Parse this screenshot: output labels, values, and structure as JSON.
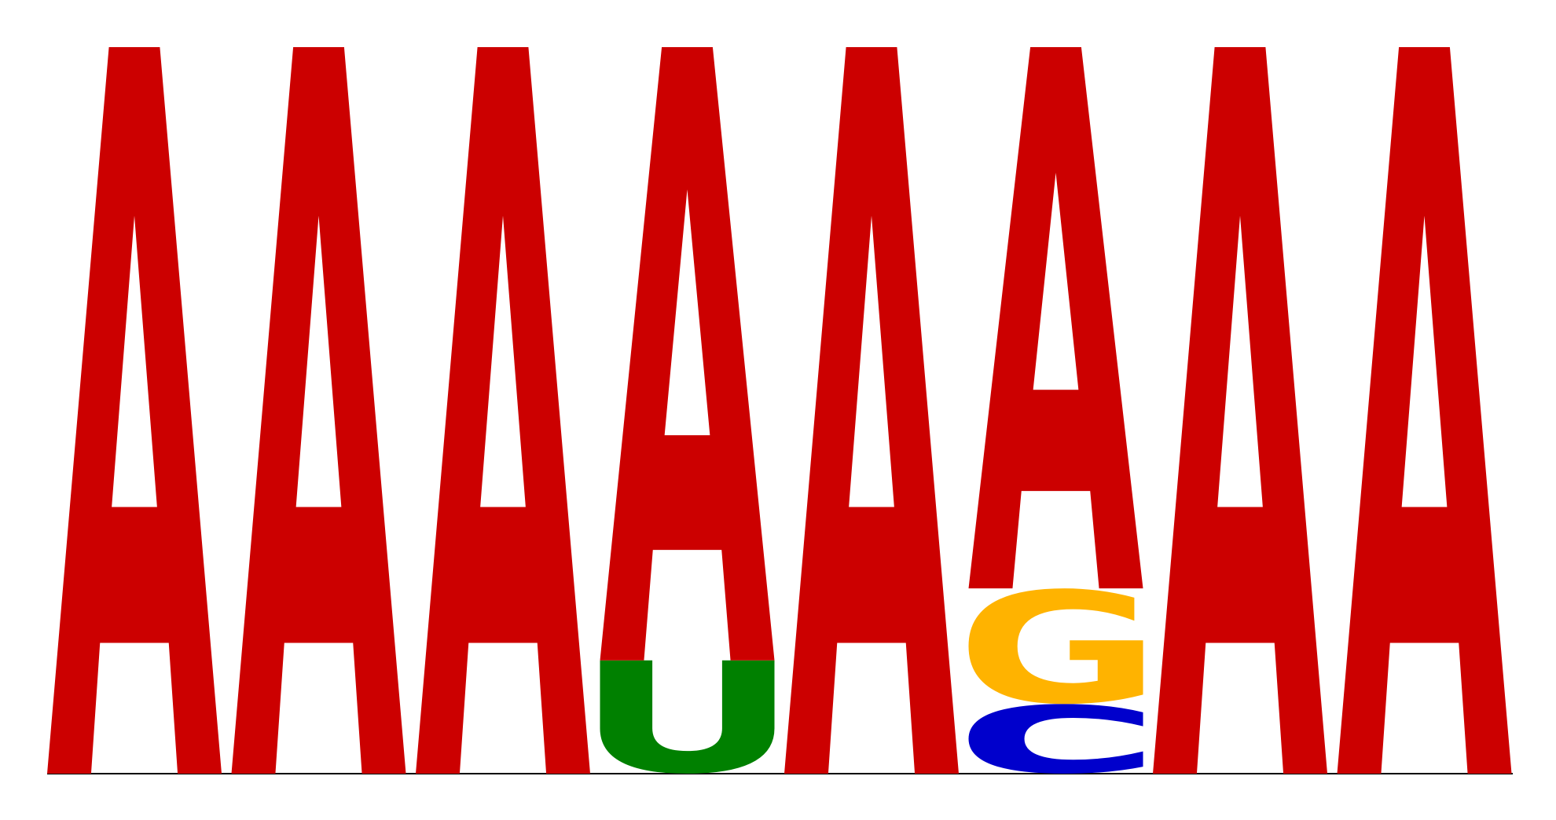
{
  "chart_data": {
    "type": "sequence-logo",
    "positions": [
      {
        "position": 1,
        "letters": [
          {
            "letter": "A",
            "height": 1.0
          }
        ]
      },
      {
        "position": 2,
        "letters": [
          {
            "letter": "A",
            "height": 1.0
          }
        ]
      },
      {
        "position": 3,
        "letters": [
          {
            "letter": "A",
            "height": 1.0
          }
        ]
      },
      {
        "position": 4,
        "letters": [
          {
            "letter": "U",
            "height": 0.156
          },
          {
            "letter": "A",
            "height": 0.844
          }
        ]
      },
      {
        "position": 5,
        "letters": [
          {
            "letter": "A",
            "height": 1.0
          }
        ]
      },
      {
        "position": 6,
        "letters": [
          {
            "letter": "C",
            "height": 0.096
          },
          {
            "letter": "G",
            "height": 0.159
          },
          {
            "letter": "A",
            "height": 0.745
          }
        ]
      },
      {
        "position": 7,
        "letters": [
          {
            "letter": "A",
            "height": 1.0
          }
        ]
      },
      {
        "position": 8,
        "letters": [
          {
            "letter": "A",
            "height": 1.0
          }
        ]
      }
    ],
    "letter_colors": {
      "A": "#cc0000",
      "C": "#0000cc",
      "G": "#ffb300",
      "U": "#008000"
    }
  }
}
